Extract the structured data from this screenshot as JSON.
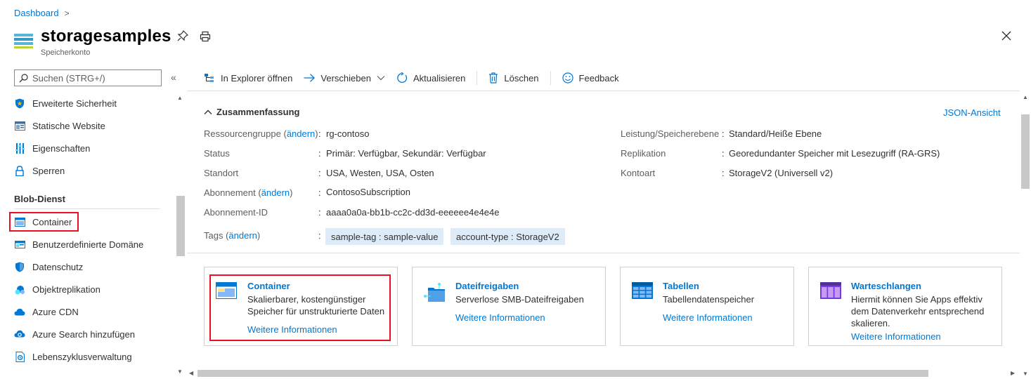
{
  "header": {
    "breadcrumb": "Dashboard",
    "title": "storagesamples",
    "subtitle": "Speicherkonto"
  },
  "sidebar": {
    "search_placeholder": "Suchen (STRG+/)",
    "items_top": [
      {
        "label": "Erweiterte Sicherheit",
        "icon": "shield-icon"
      },
      {
        "label": "Statische Website",
        "icon": "website-icon"
      },
      {
        "label": "Eigenschaften",
        "icon": "properties-icon"
      },
      {
        "label": "Sperren",
        "icon": "lock-icon"
      }
    ],
    "section": "Blob-Dienst",
    "items_blob": [
      {
        "label": "Container",
        "icon": "container-icon"
      },
      {
        "label": "Benutzerdefinierte Domäne",
        "icon": "domain-icon"
      },
      {
        "label": "Datenschutz",
        "icon": "data-protection-icon"
      },
      {
        "label": "Objektreplikation",
        "icon": "replication-icon"
      },
      {
        "label": "Azure CDN",
        "icon": "cloud-icon"
      },
      {
        "label": "Azure Search hinzufügen",
        "icon": "cloud-search-icon"
      },
      {
        "label": "Lebenszyklusverwaltung",
        "icon": "lifecycle-icon"
      }
    ]
  },
  "toolbar": {
    "explorer": "In Explorer öffnen",
    "move": "Verschieben",
    "refresh": "Aktualisieren",
    "delete": "Löschen",
    "feedback": "Feedback"
  },
  "essentials": {
    "title": "Zusammenfassung",
    "json_link": "JSON-Ansicht",
    "change_link": "ändern",
    "left": [
      {
        "label": "Ressourcengruppe",
        "value": "rg-contoso"
      },
      {
        "label": "Status",
        "value": "Primär: Verfügbar, Sekundär: Verfügbar"
      },
      {
        "label": "Standort",
        "value": "USA, Westen, USA, Osten"
      },
      {
        "label": "Abonnement",
        "value": "ContosoSubscription"
      },
      {
        "label": "Abonnement-ID",
        "value": "aaaa0a0a-bb1b-cc2c-dd3d-eeeeee4e4e4e"
      },
      {
        "label": "Tags"
      }
    ],
    "right": [
      {
        "label": "Leistung/Speicherebene",
        "value": "Standard/Heiße Ebene"
      },
      {
        "label": "Replikation",
        "value": "Georedundanter Speicher mit Lesezugriff (RA-GRS)"
      },
      {
        "label": "Kontoart",
        "value": "StorageV2 (Universell v2)"
      }
    ],
    "tags": [
      "sample-tag : sample-value",
      "account-type : StorageV2"
    ]
  },
  "cards": [
    {
      "title": "Container",
      "desc1": "Skalierbarer, kostengünstiger",
      "desc2": "Speicher für unstrukturierte Daten",
      "link": "Weitere Informationen"
    },
    {
      "title": "Dateifreigaben",
      "desc1": "Serverlose SMB-Dateifreigaben",
      "link": "Weitere Informationen"
    },
    {
      "title": "Tabellen",
      "desc1": "Tabellendatenspeicher",
      "link": "Weitere Informationen"
    },
    {
      "title": "Warteschlangen",
      "desc1": "Hiermit können Sie Apps effektiv",
      "desc2": "dem Datenverkehr entsprechend",
      "desc3": "skalieren.",
      "link": "Weitere Informationen"
    }
  ],
  "colors": {
    "accent": "#0078d4",
    "highlight": "#e81123",
    "tag_bg": "#deecf9"
  }
}
